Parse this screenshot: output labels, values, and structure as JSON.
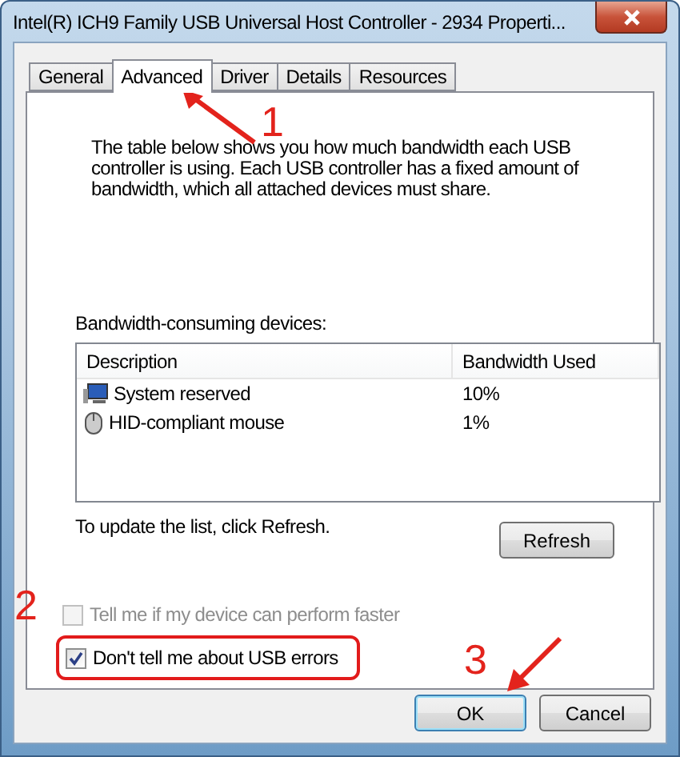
{
  "window": {
    "title": "Intel(R) ICH9 Family USB Universal Host Controller - 2934 Properti..."
  },
  "tabs": [
    {
      "label": "General",
      "selected": false
    },
    {
      "label": "Advanced",
      "selected": true
    },
    {
      "label": "Driver",
      "selected": false
    },
    {
      "label": "Details",
      "selected": false
    },
    {
      "label": "Resources",
      "selected": false
    }
  ],
  "description": "The table below shows you how much bandwidth each USB controller is using. Each USB controller has a fixed amount of bandwidth, which all attached devices must share.",
  "devices_label": "Bandwidth-consuming devices:",
  "table": {
    "columns": [
      "Description",
      "Bandwidth Used"
    ],
    "rows": [
      {
        "kind": "monitor",
        "name": "System reserved",
        "bandwidth": "10%"
      },
      {
        "kind": "mouse",
        "name": "HID-compliant mouse",
        "bandwidth": "1%"
      }
    ]
  },
  "refresh_hint": "To update the list, click Refresh.",
  "refresh_button": "Refresh",
  "checkboxes": [
    {
      "label": "Tell me if my device can perform faster",
      "checked": false,
      "disabled": true,
      "highlighted": false
    },
    {
      "label": "Don't tell me about USB errors",
      "checked": true,
      "disabled": false,
      "highlighted": true
    }
  ],
  "buttons": [
    {
      "label": "OK",
      "default": true
    },
    {
      "label": "Cancel",
      "default": false
    }
  ],
  "annotations": [
    {
      "label": "1",
      "kind": "arrow"
    },
    {
      "label": "2",
      "kind": "plain"
    },
    {
      "label": "3",
      "kind": "arrow"
    }
  ]
}
